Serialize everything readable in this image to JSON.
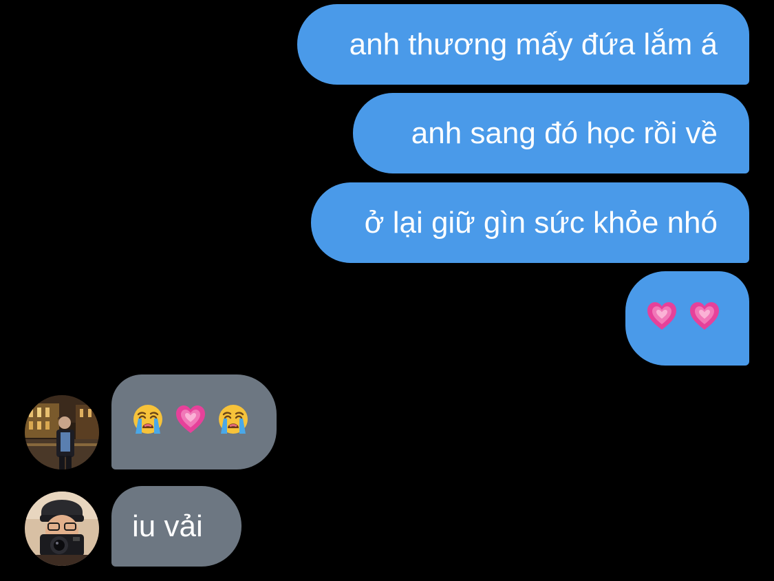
{
  "conversation": {
    "sent_messages": [
      {
        "text": "anh thương mấy đứa lắm á"
      },
      {
        "text": "anh sang đó học rồi về"
      },
      {
        "text": "ở lại giữ gìn sức khỏe nhó"
      },
      {
        "text": "💗 💗",
        "icons": [
          "heart-icon",
          "heart-icon"
        ]
      }
    ],
    "received_messages": [
      {
        "text": "😭 💗 😭",
        "icons": [
          "crying-face-icon",
          "heart-icon",
          "crying-face-icon"
        ]
      },
      {
        "text": "iu vải"
      }
    ]
  },
  "colors": {
    "background": "#000000",
    "sent_bubble": "#4a9ae9",
    "received_bubble": "#6d7782",
    "text": "#ffffff",
    "heart": "#e6419a"
  }
}
